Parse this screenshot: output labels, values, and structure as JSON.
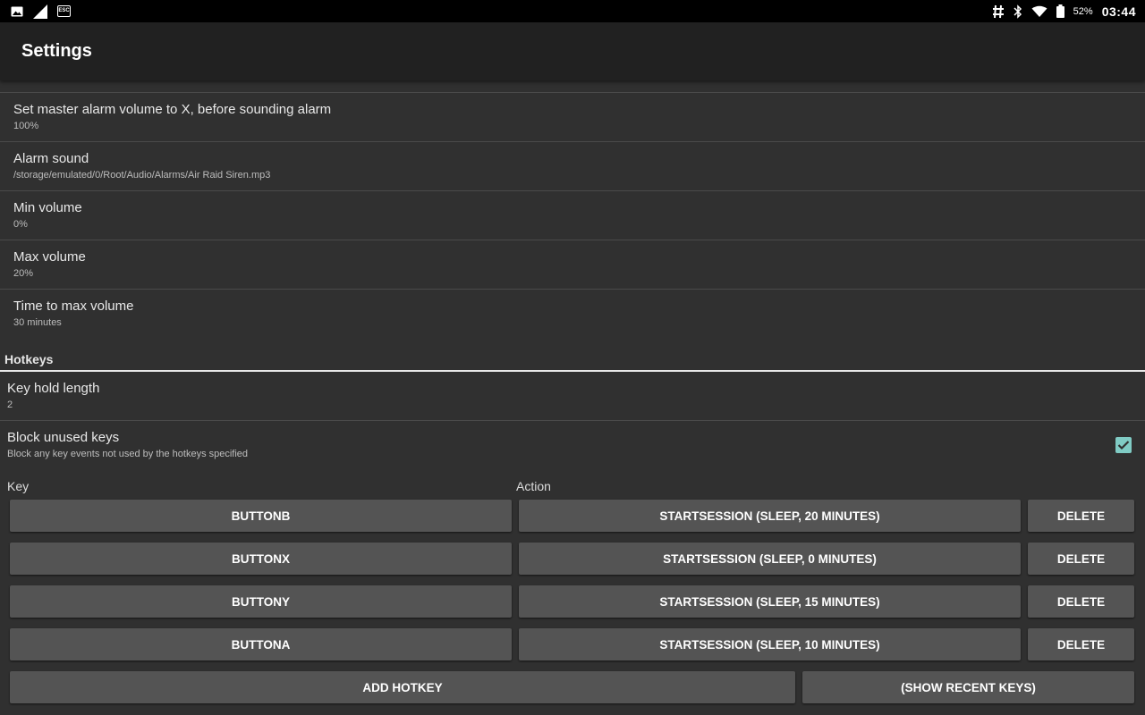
{
  "status_bar": {
    "icons_left": [
      "image-icon",
      "signal-icon",
      "esc-key-icon"
    ],
    "esc_label": "ESC",
    "icons_right": [
      "hash-icon",
      "bluetooth-icon",
      "wifi-icon",
      "battery-icon"
    ],
    "battery": "52%",
    "time": "03:44"
  },
  "toolbar": {
    "title": "Settings"
  },
  "prefs": [
    {
      "title": "Set master alarm volume to X, before sounding alarm",
      "summary": "100%"
    },
    {
      "title": "Alarm sound",
      "summary": "/storage/emulated/0/Root/Audio/Alarms/Air Raid Siren.mp3"
    },
    {
      "title": "Min volume",
      "summary": "0%"
    },
    {
      "title": "Max volume",
      "summary": "20%"
    },
    {
      "title": "Time to max volume",
      "summary": "30 minutes"
    }
  ],
  "hotkeys": {
    "category": "Hotkeys",
    "key_hold": {
      "title": "Key hold length",
      "summary": "2"
    },
    "block_unused": {
      "title": "Block unused keys",
      "summary": "Block any key events not used by the hotkeys specified",
      "checked": true
    },
    "key_header": "Key",
    "action_header": "Action",
    "rows": [
      {
        "key": "BUTTONB",
        "action": "STARTSESSION (SLEEP, 20 MINUTES)",
        "delete": "DELETE"
      },
      {
        "key": "BUTTONX",
        "action": "STARTSESSION (SLEEP, 0 MINUTES)",
        "delete": "DELETE"
      },
      {
        "key": "BUTTONY",
        "action": "STARTSESSION (SLEEP, 15 MINUTES)",
        "delete": "DELETE"
      },
      {
        "key": "BUTTONA",
        "action": "STARTSESSION (SLEEP, 10 MINUTES)",
        "delete": "DELETE"
      }
    ],
    "add_hotkey": "ADD HOTKEY",
    "show_recent": "(SHOW RECENT KEYS)"
  },
  "colors": {
    "background": "#303030",
    "toolbar": "#212121",
    "button": "#545454",
    "accent": "#80cbc4"
  }
}
